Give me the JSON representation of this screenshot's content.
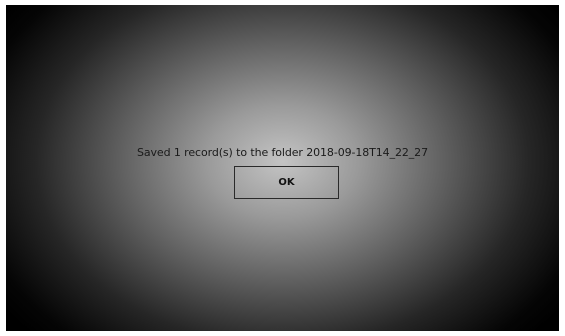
{
  "dialog": {
    "message": "Saved 1 record(s) to the folder 2018-09-18T14_22_27",
    "ok_label": "OK"
  }
}
